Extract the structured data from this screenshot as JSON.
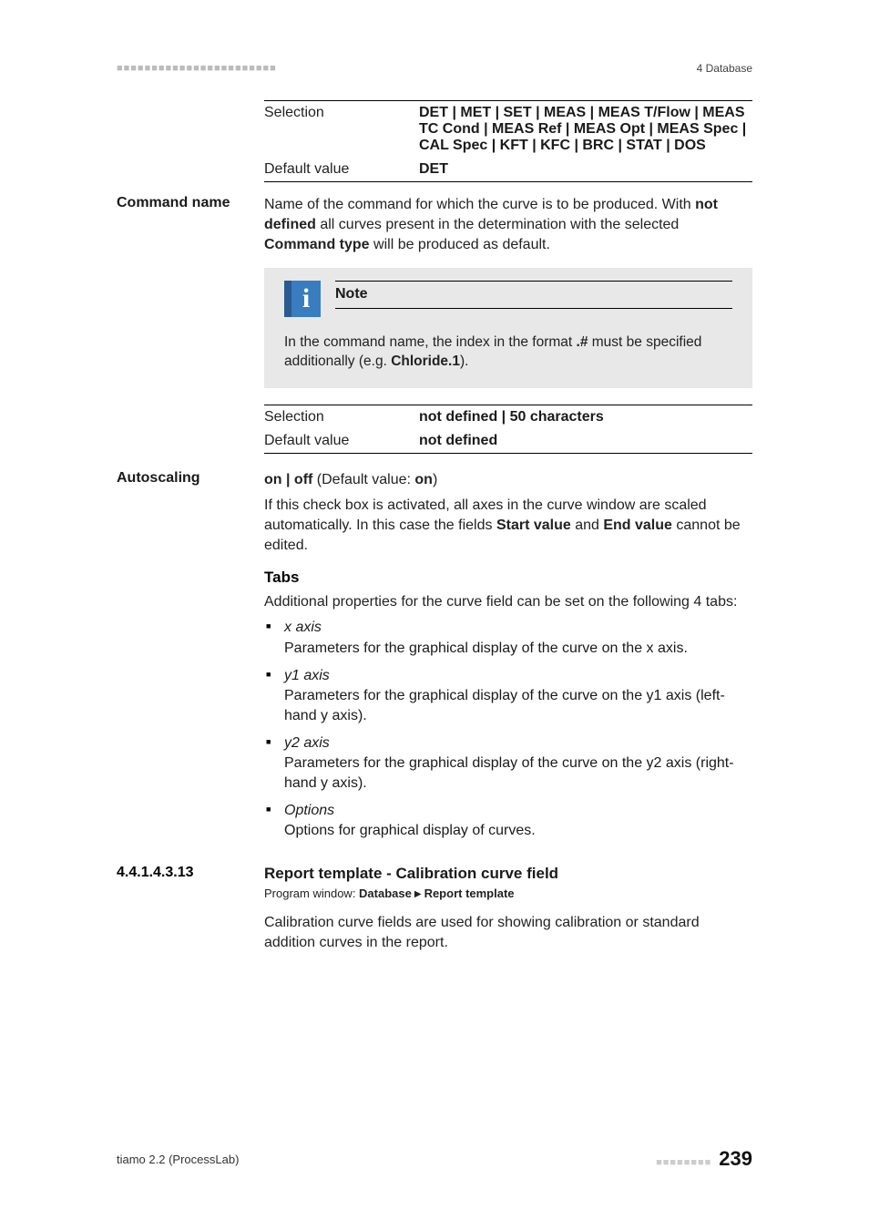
{
  "header": {
    "left_dots": "■■■■■■■■■■■■■■■■■■■■■■■",
    "right_label": "4 Database"
  },
  "param1": {
    "selection_label": "Selection",
    "selection_value": "DET | MET | SET | MEAS | MEAS T/Flow | MEAS TC Cond | MEAS Ref | MEAS Opt | MEAS Spec | CAL Spec | KFT | KFC | BRC | STAT | DOS",
    "default_label": "Default value",
    "default_value": "DET"
  },
  "command_name": {
    "heading": "Command name",
    "body_prefix": "Name of the command for which the curve is to be produced. With ",
    "body_bold1": "not defined",
    "body_mid": " all curves present in the determination with the selected ",
    "body_bold2": "Command type",
    "body_suffix": " will be produced as default."
  },
  "note": {
    "title": "Note",
    "body_prefix": "In the command name, the index in the format ",
    "body_bold1": ".#",
    "body_mid": " must be specified additionally (e.g. ",
    "body_bold2": "Chloride.1",
    "body_suffix": ")."
  },
  "param2": {
    "selection_label": "Selection",
    "selection_value": "not defined | 50 characters",
    "default_label": "Default value",
    "default_value": "not defined"
  },
  "autoscaling": {
    "heading": "Autoscaling",
    "toggle_prefix": "on | off",
    "toggle_paren1": " (Default value: ",
    "toggle_default": "on",
    "toggle_paren2": ")",
    "body_prefix": "If this check box is activated, all axes in the curve window are scaled automatically. In this case the fields ",
    "body_bold1": "Start value",
    "body_mid": " and ",
    "body_bold2": "End value",
    "body_suffix": " cannot be edited."
  },
  "tabs": {
    "title": "Tabs",
    "intro": "Additional properties for the curve field can be set on the following 4 tabs:",
    "items": [
      {
        "name": "x axis",
        "desc": "Parameters for the graphical display of the curve on the x axis."
      },
      {
        "name": "y1 axis",
        "desc": "Parameters for the graphical display of the curve on the y1 axis (left-hand y axis)."
      },
      {
        "name": "y2 axis",
        "desc": "Parameters for the graphical display of the curve on the y2 axis (right-hand y axis)."
      },
      {
        "name": "Options",
        "desc": "Options for graphical display of curves."
      }
    ]
  },
  "subsection": {
    "number": "4.4.1.4.3.13",
    "title": "Report template - Calibration curve field",
    "pw_label": "Program window: ",
    "pw_bold1": "Database",
    "pw_sep": "▶",
    "pw_bold2": "Report template",
    "body": "Calibration curve fields are used for showing calibration or standard addition curves in the report."
  },
  "footer": {
    "left": "tiamo 2.2 (ProcessLab)",
    "dots": "■■■■■■■■",
    "page": "239"
  }
}
